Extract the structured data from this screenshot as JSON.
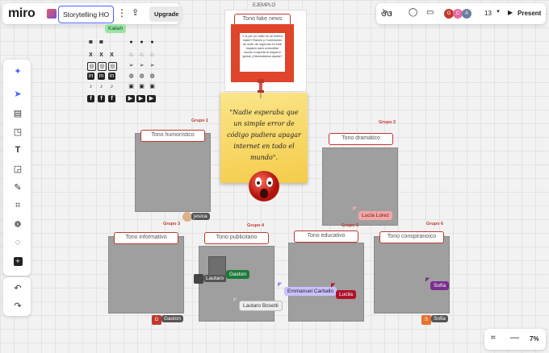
{
  "app": {
    "logo": "miro",
    "board_name": "Storytelling HO",
    "upgrade_label": "Upgrade",
    "present_label": "Present",
    "collaborator_count": "13",
    "zoom": "7%"
  },
  "colors": {
    "accent": "#4262ff",
    "section_red": "#c0392b",
    "sticky": "#f5d76e",
    "kailah": "#9be2a6",
    "lucia": "#f6a5a5",
    "sofia": "#7b2d8e",
    "emmanuel": "#9b8cff",
    "gaston": "#1e7a3a",
    "lucila": "#b0102c"
  },
  "kailah_tag": "Kailah",
  "ejemplo": {
    "label": "EJEMPLO",
    "title": "Tono fake news",
    "card_text": "Y si por un ratito no se entera nadie? Raíces y Conexiones se unen de urgencia en este espacio para consolidar acción conjunta la mayoría global ¿Necesitamos ayuda?"
  },
  "sticky": {
    "text": "\"Nadie esperaba que un simple error de código pudiera apagar internet en todo el mundo\"."
  },
  "groups": [
    {
      "label": "Grupo 1",
      "title": "Tono humorístico",
      "user": "jesica"
    },
    {
      "label": "Grupo 2",
      "title": "Tono dramático",
      "user": "Lucía Lorez"
    },
    {
      "label": "Grupo 3",
      "title": "Tono informativo",
      "user": "Gaston"
    },
    {
      "label": "Grupo 4",
      "title": "Tono publicitario",
      "user": "Lautaro"
    },
    {
      "label": "Grupo 5",
      "title": "Tono educativo",
      "user": "Emmanuel Carballo"
    },
    {
      "label": "Grupo 6",
      "title": "Tono conspiranoico",
      "user": "Sofia"
    }
  ],
  "cursors": {
    "gaston": "Gaston",
    "lautaro_bosetti": "Lautaro Bosetti",
    "lucila": "Lucila",
    "sofia": "Sofía"
  },
  "avatars": [
    {
      "initial": "G"
    },
    {
      "initial": "C"
    },
    {
      "initial": "A"
    }
  ]
}
